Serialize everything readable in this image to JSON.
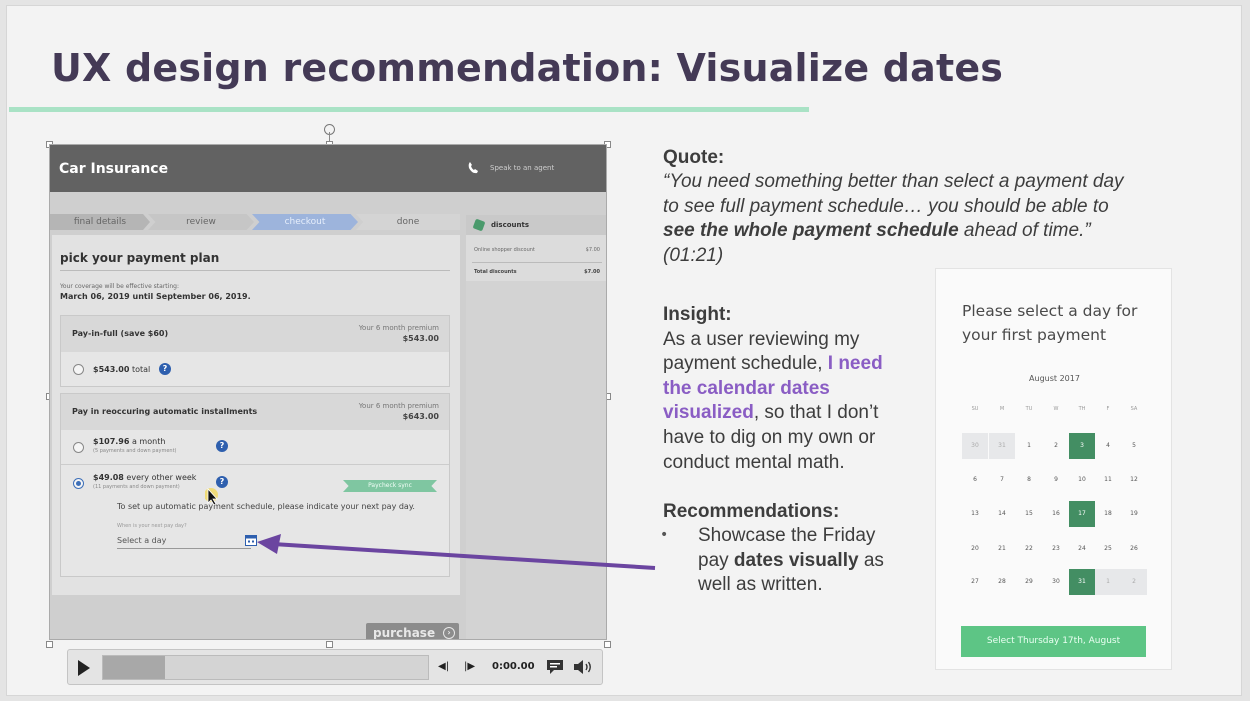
{
  "slide": {
    "title": "UX design recommendation: Visualize dates"
  },
  "app": {
    "title": "Car Insurance",
    "agent_link": "Speak to an agent",
    "steps": [
      "final details",
      "review",
      "checkout",
      "done"
    ],
    "plan_title": "pick your payment plan",
    "coverage_label": "Your coverage will be effective starting:",
    "coverage_dates": "March 06, 2019 until September 06, 2019.",
    "pay_in_full": {
      "label": "Pay-in-full (save $60)",
      "premium_label": "Your 6 month premium",
      "premium": "$543.00",
      "option_amount": "$543.00",
      "option_suffix": "total"
    },
    "installments": {
      "label": "Pay in reoccuring automatic installments",
      "premium_label": "Your 6 month premium",
      "premium": "$643.00",
      "monthly_amount": "$107.96",
      "monthly_suffix": "a month",
      "monthly_sub": "(5 payments and down payment)",
      "biweekly_amount": "$49.08",
      "biweekly_suffix": "every other week",
      "biweekly_sub": "(11 payments and down payment)",
      "ribbon": "Paycheck sync",
      "schedule_text": "To set up automatic payment schedule, please indicate your next pay day.",
      "payday_label": "When is your next pay day?",
      "payday_placeholder": "Select a day"
    },
    "discounts": {
      "title": "discounts",
      "rows": [
        {
          "label": "Online shopper discount",
          "value": "$7.00"
        },
        {
          "label": "Total discounts",
          "value": "$7.00"
        }
      ]
    },
    "purchase_label": "purchase",
    "help_glyph": "?"
  },
  "player": {
    "time": "0:00.00",
    "progress": 0.19
  },
  "quote": {
    "heading": "Quote:",
    "line1": "“You need something better than select a payment day",
    "line2": "to see full payment schedule… you should be able to",
    "line3_bold": "see the whole payment schedule",
    "line3_rest": " ahead of time.”",
    "timestamp": "(01:21)"
  },
  "insight": {
    "heading": "Insight:",
    "line1": "As a user reviewing my",
    "line2_a": "payment schedule, ",
    "line2_b": "I need",
    "line3": "the calendar dates",
    "line4_a": "visualized",
    "line4_b": ", so that I don’t",
    "line5": "have to dig on my own or",
    "line6": "conduct mental math."
  },
  "recommendations": {
    "heading": "Recommendations:",
    "bullet": "•",
    "line1": "Showcase the Friday",
    "line2_a": "pay ",
    "line2_b": "dates visually",
    "line2_c": " as",
    "line3": "well as written."
  },
  "calendar": {
    "prompt": "Please select a day for your first payment",
    "month": "August 2017",
    "weekdays": [
      "SU",
      "M",
      "TU",
      "W",
      "TH",
      "F",
      "SA"
    ],
    "weeks": [
      [
        "30",
        "31",
        "1",
        "2",
        "3",
        "4",
        "5"
      ],
      [
        "6",
        "7",
        "8",
        "9",
        "10",
        "11",
        "12"
      ],
      [
        "13",
        "14",
        "15",
        "16",
        "17",
        "18",
        "19"
      ],
      [
        "20",
        "21",
        "22",
        "23",
        "24",
        "25",
        "26"
      ],
      [
        "27",
        "28",
        "29",
        "30",
        "31",
        "1",
        "2"
      ]
    ],
    "button": "Select Thursday 17th, August"
  },
  "colors": {
    "title": "#443a56",
    "accent_rule": "#a9e2c5",
    "purple_highlight": "#8a5dc4",
    "arrow": "#6b45a0",
    "calendar_selected": "#438e63",
    "calendar_button": "#5dc585"
  }
}
